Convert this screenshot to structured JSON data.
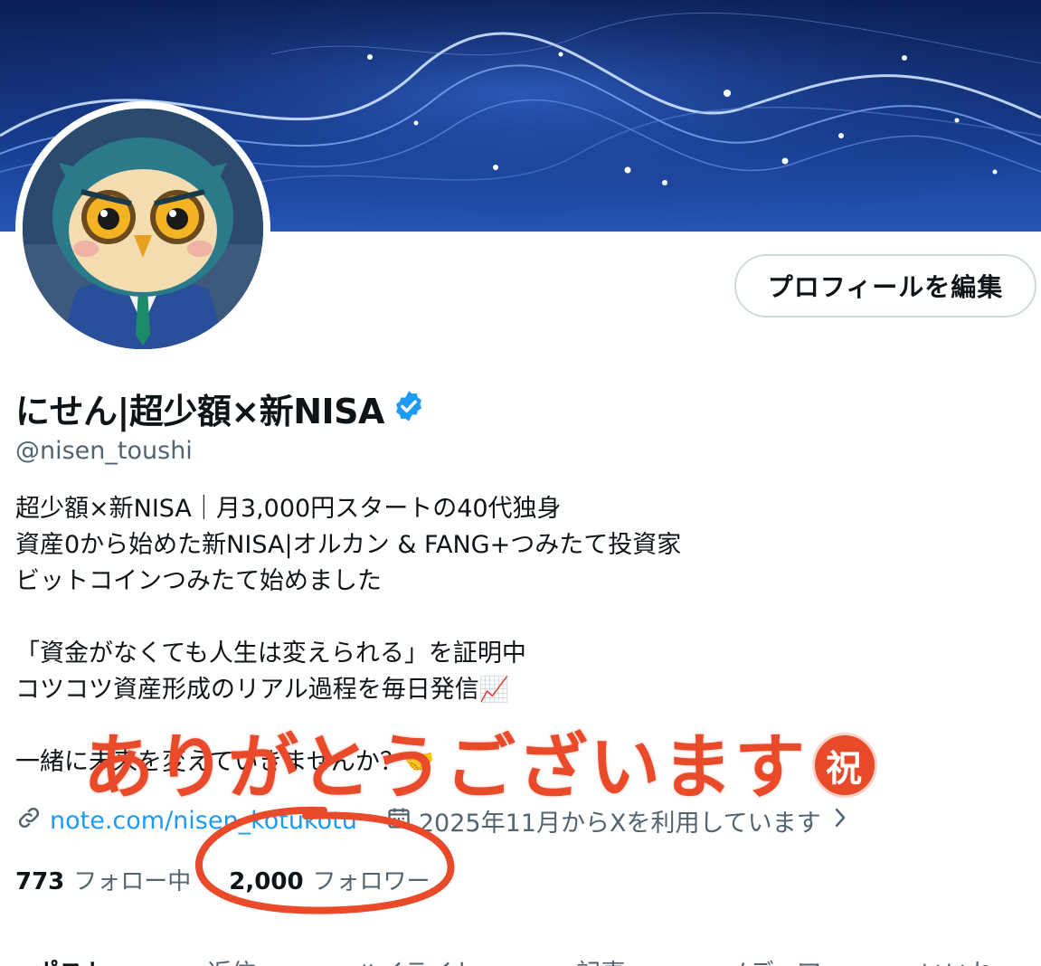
{
  "profile": {
    "display_name": "にせん|超少額×新NISA",
    "handle": "@nisen_toushi",
    "edit_button": "プロフィールを編集",
    "verified_icon": "verified-badge-icon",
    "bio": [
      "超少額×新NISA｜月3,000円スタートの40代独身",
      "資産0から始めた新NISA|オルカン & FANG+つみたて投資家",
      "ビットコインつみたて始めました",
      "",
      "「資金がなくても人生は変えられる」を証明中",
      "コツコツ資産形成のリアル過程を毎日発信📈",
      "",
      "一緒に未来を変えていきませんか？🤝"
    ],
    "link": "note.com/nisen_kotukotu",
    "joined": "2025年11月からXを利用しています",
    "following_count": "773",
    "following_label": "フォロー中",
    "followers_count": "2,000",
    "followers_label": "フォロワー"
  },
  "overlay": {
    "message": "ありがとうございます",
    "stamp": "祝",
    "accent_color": "#e84a2a"
  },
  "tabs": [
    {
      "label": "ポスト"
    },
    {
      "label": "返信"
    },
    {
      "label": "ハイライト"
    },
    {
      "label": "記事"
    },
    {
      "label": "メディア"
    },
    {
      "label": "いいね"
    }
  ],
  "colors": {
    "accent": "#1d9bf0",
    "muted": "#536471",
    "text": "#0f1419",
    "annotation": "#e84a2a"
  }
}
